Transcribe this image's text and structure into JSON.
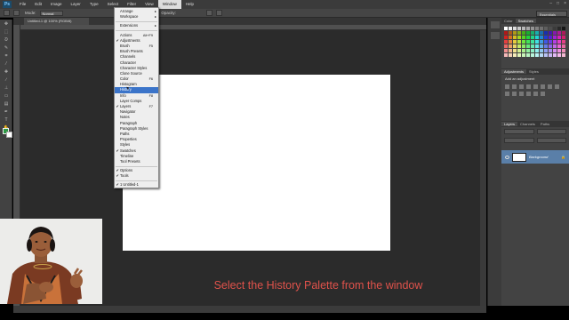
{
  "menubar": {
    "logo": "Ps",
    "items": [
      "File",
      "Edit",
      "Image",
      "Layer",
      "Type",
      "Select",
      "Filter",
      "View",
      "Window",
      "Help"
    ],
    "active_index": 8
  },
  "optbar": {
    "mode_label": "Mode:",
    "mode_value": "Normal",
    "opacity_label": "Opacity:",
    "workspace": "Essentials"
  },
  "document": {
    "tab_title": "Untitled-1 @ 100% (RGB/8)"
  },
  "window_menu": {
    "items": [
      {
        "label": "Arrange",
        "arrow": true
      },
      {
        "label": "Workspace",
        "arrow": true
      },
      {
        "sep": true
      },
      {
        "label": "Extensions",
        "arrow": true
      },
      {
        "sep": true
      },
      {
        "label": "Actions",
        "shortcut": "Alt+F9"
      },
      {
        "label": "Adjustments",
        "checked": true
      },
      {
        "label": "Brush",
        "shortcut": "F5"
      },
      {
        "label": "Brush Presets"
      },
      {
        "label": "Channels"
      },
      {
        "label": "Character"
      },
      {
        "label": "Character Styles"
      },
      {
        "label": "Clone Source"
      },
      {
        "label": "Color",
        "shortcut": "F6"
      },
      {
        "label": "Histogram"
      },
      {
        "label": "History",
        "highlight": true
      },
      {
        "label": "Info",
        "shortcut": "F8"
      },
      {
        "label": "Layer Comps"
      },
      {
        "label": "Layers",
        "checked": true,
        "shortcut": "F7"
      },
      {
        "label": "Navigator"
      },
      {
        "label": "Notes"
      },
      {
        "label": "Paragraph"
      },
      {
        "label": "Paragraph Styles"
      },
      {
        "label": "Paths"
      },
      {
        "label": "Properties"
      },
      {
        "label": "Styles"
      },
      {
        "label": "Swatches",
        "checked": true
      },
      {
        "label": "Timeline"
      },
      {
        "label": "Tool Presets"
      },
      {
        "sep": true
      },
      {
        "label": "Options",
        "checked": true
      },
      {
        "label": "Tools",
        "checked": true
      },
      {
        "sep": true
      },
      {
        "label": "1 Untitled-1",
        "checked": true
      }
    ]
  },
  "panels": {
    "color_tabs": [
      "Color",
      "Swatches"
    ],
    "adjust_tabs": [
      "Adjustments",
      "Styles"
    ],
    "adjust_title": "Add an adjustment",
    "layers_tabs": [
      "Layers",
      "Channels",
      "Paths"
    ],
    "layer_name": "Background"
  },
  "caption": "Select the History Palette from the window",
  "colors": {
    "accent_highlight": "#3b74c9",
    "caption": "#e0524b",
    "layer_selected": "#5a7fa8"
  }
}
